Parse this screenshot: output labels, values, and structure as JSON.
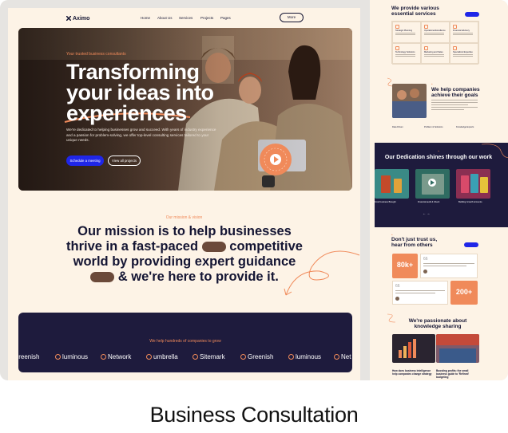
{
  "nav": {
    "logo": "Aximo",
    "links": [
      "Home",
      "About Us",
      "Services",
      "Projects",
      "Pages"
    ],
    "more": "More"
  },
  "hero": {
    "kicker": "Your trusted business consultants",
    "title_line1": "Transforming",
    "title_line2": "your ideas into",
    "title_line3": "experiences",
    "description": "We're dedicated to helping businesses grow and succeed. With years of industry experience and a passion for problem-solving, we offer top-level consulting services tailored to your unique needs.",
    "primary_cta": "Schedule a meeting",
    "secondary_cta": "View all projects"
  },
  "mission": {
    "kicker": "Our mission & vision",
    "line1": "Our mission is to help businesses",
    "line2a": "thrive in a fast-paced",
    "line2b": "competitive",
    "line3": "world by providing expert guidance",
    "line4": "& we're here to provide it."
  },
  "logos": {
    "title": "We help hundreds of companies to grow",
    "brands": [
      "Greenish",
      "luminous",
      "Network",
      "umbrella",
      "Sitemark",
      "Greenish",
      "luminous",
      "Net"
    ]
  },
  "side": {
    "services_title": "We provide various essential services",
    "services": [
      "Strategic Planning",
      "Operational Excellence",
      "Financial Advisory",
      "Technology Solutions",
      "Marketing and Sales",
      "Specialized Expertise"
    ],
    "help_title": "We help companies achieve their goals",
    "help_items": [
      "Data Driven",
      "Problem & Solutions",
      "Knowledge Experts"
    ],
    "dedication_title": "Dedication shines through our work",
    "dedication_prefix": "Our",
    "projects": [
      "Food business Brought",
      "Financial audit & Check",
      "Building Growth Accounts"
    ],
    "trust_title": "Don't just trust us, hear from others",
    "stat1": "80k+",
    "stat2": "200+",
    "knowledge_title": "We're passionate about knowledge sharing",
    "posts": [
      "How does business intelligence help companies change strategy",
      "Boosting profits: the small business guide to 'Refined' budgeting"
    ]
  },
  "caption": "Business Consultation",
  "colors": {
    "accent": "#f08a5a",
    "primary": "#1f26e8",
    "navy": "#1e1b3d",
    "cream": "#fdf3e6"
  }
}
